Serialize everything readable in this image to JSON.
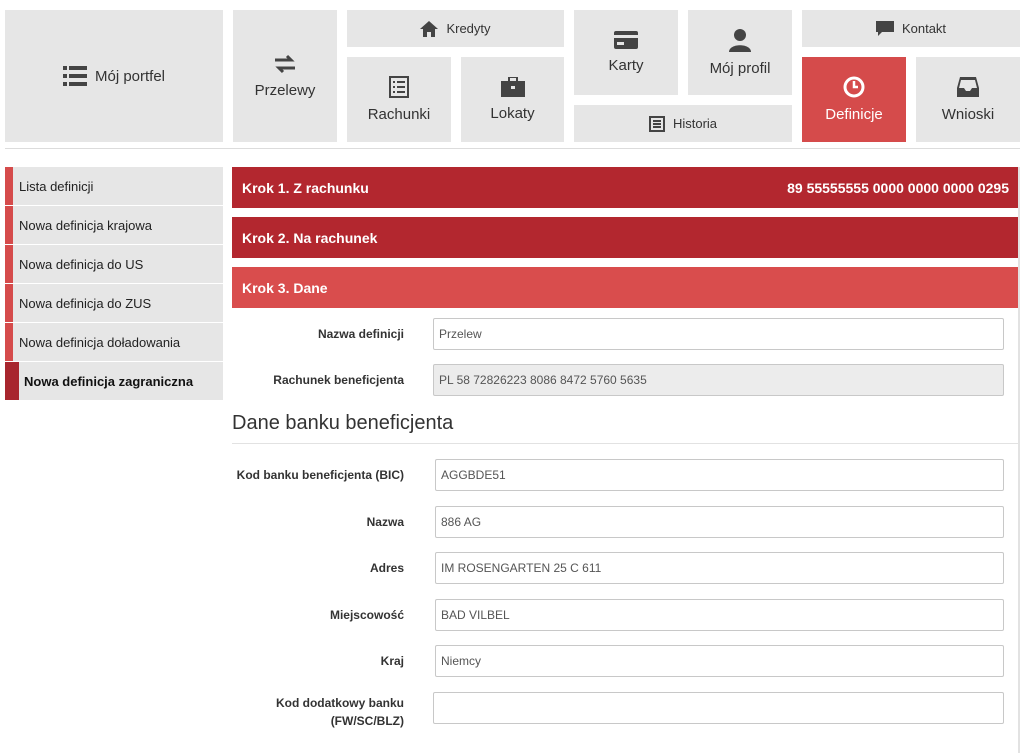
{
  "nav": {
    "portfolio": "Mój portfel",
    "transfers": "Przelewy",
    "credits": "Kredyty",
    "accounts": "Rachunki",
    "deposits": "Lokaty",
    "cards": "Karty",
    "history": "Historia",
    "profile": "Mój profil",
    "contact": "Kontakt",
    "definitions": "Definicje",
    "applications": "Wnioski",
    "active": "definitions",
    "accent_color": "#d54b4b"
  },
  "sidebar": {
    "items": [
      {
        "label": "Lista definicji"
      },
      {
        "label": "Nowa definicja krajowa"
      },
      {
        "label": "Nowa definicja do US"
      },
      {
        "label": "Nowa definicja do ZUS"
      },
      {
        "label": "Nowa definicja doładowania"
      },
      {
        "label": "Nowa definicja zagraniczna"
      }
    ],
    "active_index": 5
  },
  "steps": {
    "step1": {
      "label": "Krok 1. Z rachunku",
      "account": "89 55555555 0000 0000 0000 0295"
    },
    "step2": {
      "label": "Krok 2. Na rachunek"
    },
    "step3": {
      "label": "Krok 3. Dane"
    }
  },
  "form": {
    "definition_name": {
      "label": "Nazwa definicji",
      "value": "Przelew"
    },
    "beneficiary_account": {
      "label": "Rachunek beneficjenta",
      "value": "PL 58 72826223 8086 8472 5760 5635"
    },
    "bank_section_title": "Dane banku beneficjenta",
    "bic": {
      "label": "Kod banku beneficjenta (BIC)",
      "value": "AGGBDE51"
    },
    "name": {
      "label": "Nazwa",
      "value": "886 AG"
    },
    "address": {
      "label": "Adres",
      "value": "IM ROSENGARTEN 25 C 611"
    },
    "city": {
      "label": "Miejscowość",
      "value": "BAD VILBEL"
    },
    "country": {
      "label": "Kraj",
      "value": "Niemcy"
    },
    "extra_code": {
      "label_line1": "Kod dodatkowy banku",
      "label_line2": "(FW/SC/BLZ)",
      "value": ""
    }
  }
}
